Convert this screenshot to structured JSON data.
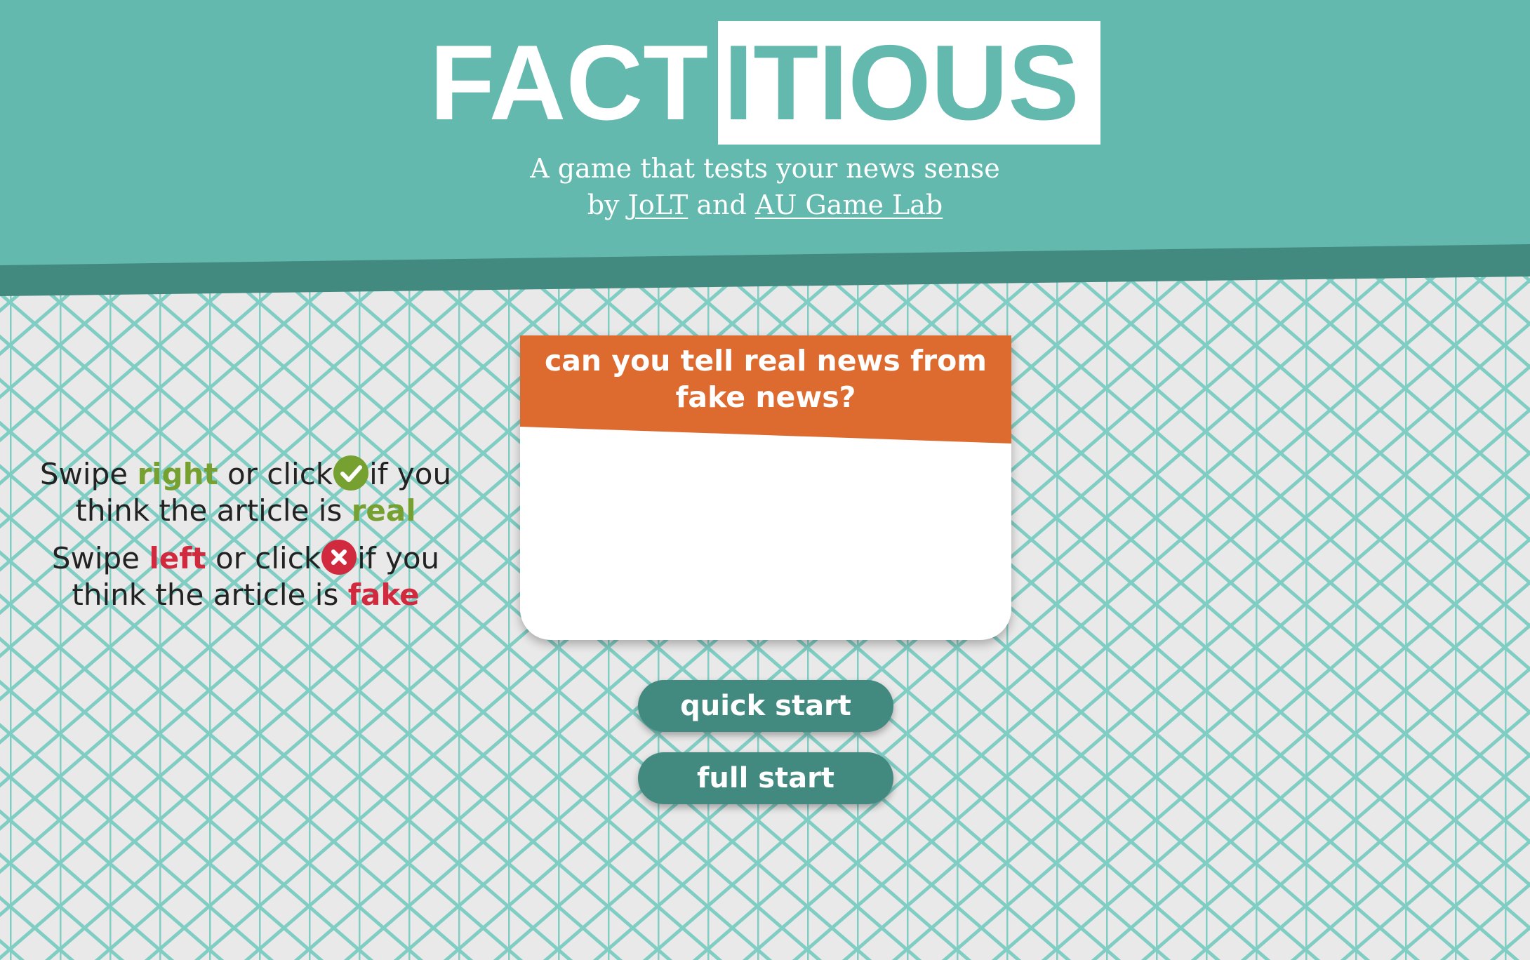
{
  "header": {
    "logo_part_a": "FACT",
    "logo_part_b": "ITIOUS",
    "tagline": "A game that tests your news sense",
    "credit_by": "by",
    "credit_link_1": "JoLT",
    "credit_and": "and",
    "credit_link_2": "AU Game Lab"
  },
  "card": {
    "title": "can you tell real news from fake news?",
    "real_line": {
      "swipe": "Swipe",
      "direction": "right",
      "or_click": "or click",
      "icon": "check-circle-icon",
      "if_you": "if you",
      "think": "think the article is",
      "verdict": "real"
    },
    "fake_line": {
      "swipe": "Swipe",
      "direction": "left",
      "or_click": "or click",
      "icon": "x-circle-icon",
      "if_you": "if you",
      "think": "think the article is",
      "verdict": "fake"
    }
  },
  "buttons": {
    "quick_start": "quick start",
    "full_start": "full start"
  },
  "colors": {
    "header_teal": "#64b9ae",
    "header_shadow": "#428a80",
    "button_teal": "#428a80",
    "banner_orange": "#dd6b30",
    "real_green": "#76a02f",
    "fake_red": "#d12a3e",
    "background": "#e9e9e9",
    "pattern_line": "#7fcdc3"
  }
}
